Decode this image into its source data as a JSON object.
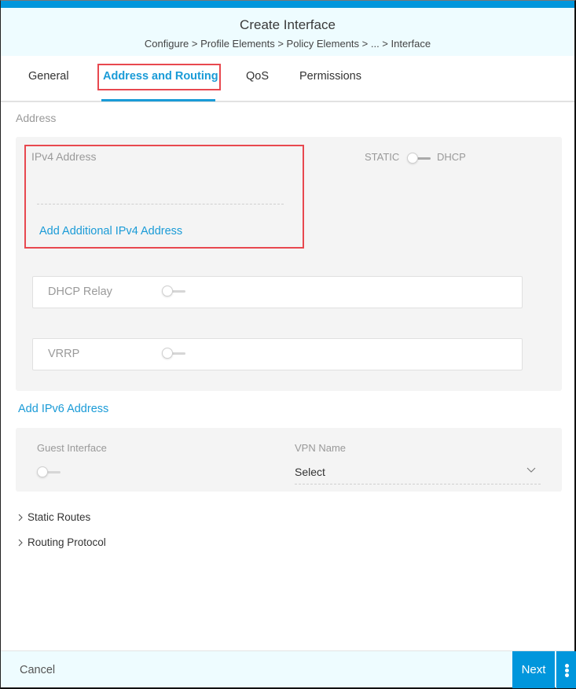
{
  "header": {
    "title": "Create Interface",
    "breadcrumb": "Configure > Profile Elements > Policy Elements > ... > Interface"
  },
  "tabs": [
    {
      "label": "General",
      "active": false
    },
    {
      "label": "Address and Routing",
      "active": true
    },
    {
      "label": "QoS",
      "active": false
    },
    {
      "label": "Permissions",
      "active": false
    }
  ],
  "address": {
    "section_label": "Address",
    "ipv4_label": "IPv4 Address",
    "ipv4_value": "",
    "add_ipv4_link": "Add Additional IPv4 Address",
    "mode_toggle": {
      "left_label": "STATIC",
      "right_label": "DHCP",
      "state": "STATIC"
    },
    "dhcp_relay": {
      "label": "DHCP Relay",
      "enabled": false
    },
    "vrrp": {
      "label": "VRRP",
      "enabled": false
    },
    "add_ipv6_link": "Add IPv6 Address"
  },
  "guest": {
    "guest_interface_label": "Guest Interface",
    "guest_interface_enabled": false,
    "vpn_name_label": "VPN Name",
    "vpn_name_value": "Select"
  },
  "collapsibles": [
    {
      "label": "Static Routes",
      "expanded": false
    },
    {
      "label": "Routing Protocol",
      "expanded": false
    }
  ],
  "footer": {
    "cancel_label": "Cancel",
    "next_label": "Next"
  },
  "colors": {
    "accent": "#0096dc",
    "link": "#1a9bd7",
    "highlight_outline": "#e8484f",
    "header_bg": "#eefcff",
    "panel_bg": "#f4f4f4"
  }
}
